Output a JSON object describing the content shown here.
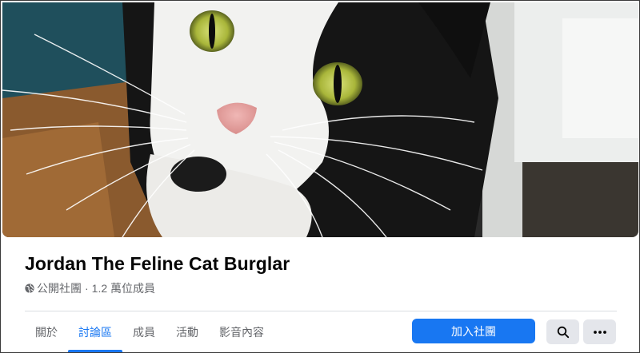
{
  "cover": {
    "icon": "cat-cover-photo"
  },
  "group": {
    "title": "Jordan The Feline Cat Burglar",
    "privacy_icon": "globe-icon",
    "privacy": "公開社團",
    "separator": "·",
    "members": "1.2 萬位成員"
  },
  "tabs": [
    {
      "label": "關於",
      "active": false
    },
    {
      "label": "討論區",
      "active": true
    },
    {
      "label": "成員",
      "active": false
    },
    {
      "label": "活動",
      "active": false
    },
    {
      "label": "影音內容",
      "active": false
    }
  ],
  "actions": {
    "join_label": "加入社團",
    "search_icon": "search-icon",
    "more_icon": "more-icon"
  },
  "colors": {
    "accent": "#1877f2",
    "secondary_text": "#65676b",
    "button_gray": "#e4e6eb"
  }
}
